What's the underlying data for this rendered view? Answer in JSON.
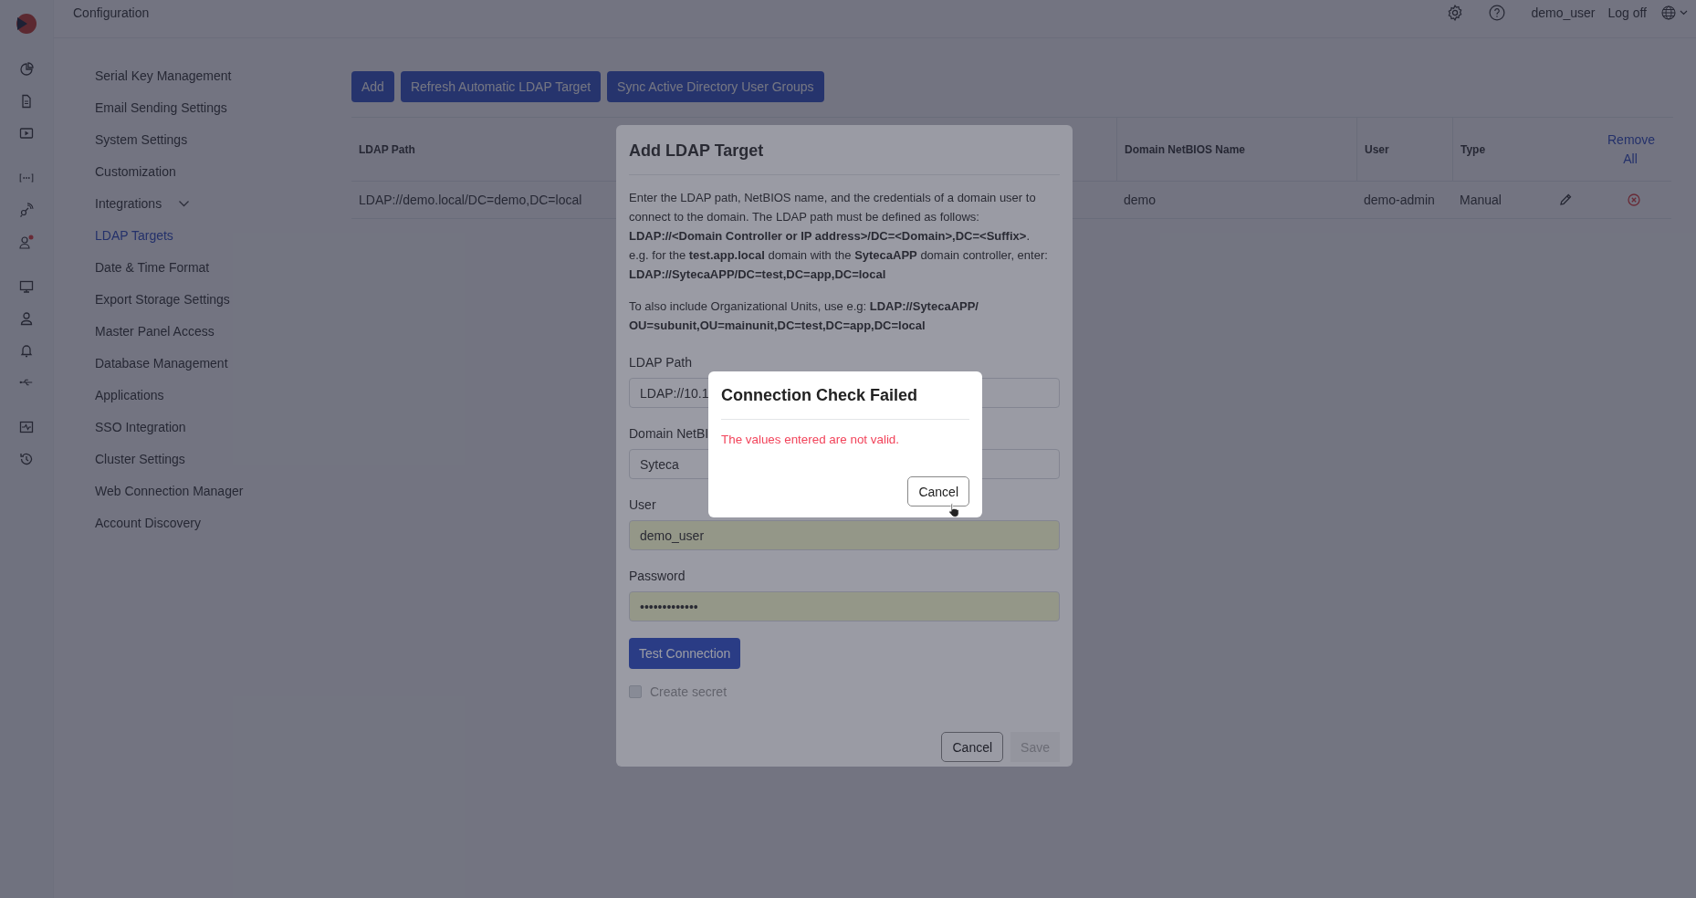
{
  "header": {
    "title": "Configuration",
    "username": "demo_user",
    "logoff": "Log off"
  },
  "nav": [
    {
      "label": "Serial Key Management",
      "kind": "link",
      "selected": false
    },
    {
      "label": "Email Sending Settings",
      "kind": "link",
      "selected": false
    },
    {
      "label": "System Settings",
      "kind": "link",
      "selected": false
    },
    {
      "label": "Customization",
      "kind": "link",
      "selected": false
    },
    {
      "label": "Integrations",
      "kind": "group",
      "selected": false
    },
    {
      "label": "LDAP Targets",
      "kind": "link",
      "selected": true
    },
    {
      "label": "Date & Time Format",
      "kind": "link",
      "selected": false
    },
    {
      "label": "Export Storage Settings",
      "kind": "link",
      "selected": false
    },
    {
      "label": "Master Panel Access",
      "kind": "link",
      "selected": false
    },
    {
      "label": "Database Management",
      "kind": "link",
      "selected": false
    },
    {
      "label": "Applications",
      "kind": "link",
      "selected": false
    },
    {
      "label": "SSO Integration",
      "kind": "link",
      "selected": false
    },
    {
      "label": "Cluster Settings",
      "kind": "link",
      "selected": false
    },
    {
      "label": "Web Connection Manager",
      "kind": "link",
      "selected": false
    },
    {
      "label": "Account Discovery",
      "kind": "link",
      "selected": false
    }
  ],
  "toolbar": [
    "Add",
    "Refresh Automatic LDAP Target",
    "Sync Active Directory User Groups"
  ],
  "table": {
    "columns": {
      "ldap_path": "LDAP Path",
      "netbios": "Domain NetBIOS Name",
      "user": "User",
      "type": "Type",
      "remove_all": "Remove All"
    },
    "rows": [
      {
        "ldap_path": "LDAP://demo.local/DC=demo,DC=local",
        "netbios": "demo",
        "user": "demo-admin",
        "type": "Manual"
      }
    ]
  },
  "modal": {
    "title": "Add LDAP Target",
    "intro": "Enter the LDAP path, NetBIOS name, and the credentials of a domain user to connect to the domain. The LDAP path must be defined as follows: **LDAP://<Domain Controller or IP address>/DC=<Domain>,DC=<Suffix>**.",
    "example": "e.g. for the **test.app.local** domain with the **SytecaAPP** domain controller, enter: **LDAP://SytecaAPP/DC=test,DC=app,DC=local**",
    "ou_hint": "To also include Organizational Units, use e.g: **LDAP://SytecaAPP/ OU=subunit,OU=mainunit,DC=test,DC=app,DC=local**",
    "fields": [
      {
        "label": "LDAP Path",
        "value": "LDAP://10.1",
        "autofill": false
      },
      {
        "label": "Domain NetBI",
        "value": "Syteca",
        "autofill": false
      },
      {
        "label": "User",
        "value": "demo_user",
        "autofill": true
      },
      {
        "label": "Password",
        "value": "•••••••••••••",
        "autofill": true
      }
    ],
    "test_button": "Test Connection",
    "create_secret": {
      "label": "Create secret",
      "checked": false,
      "disabled": true
    },
    "cancel": "Cancel",
    "save": {
      "label": "Save",
      "disabled": true
    }
  },
  "alert": {
    "title": "Connection Check Failed",
    "message": "The values entered are not valid.",
    "cancel": "Cancel"
  }
}
